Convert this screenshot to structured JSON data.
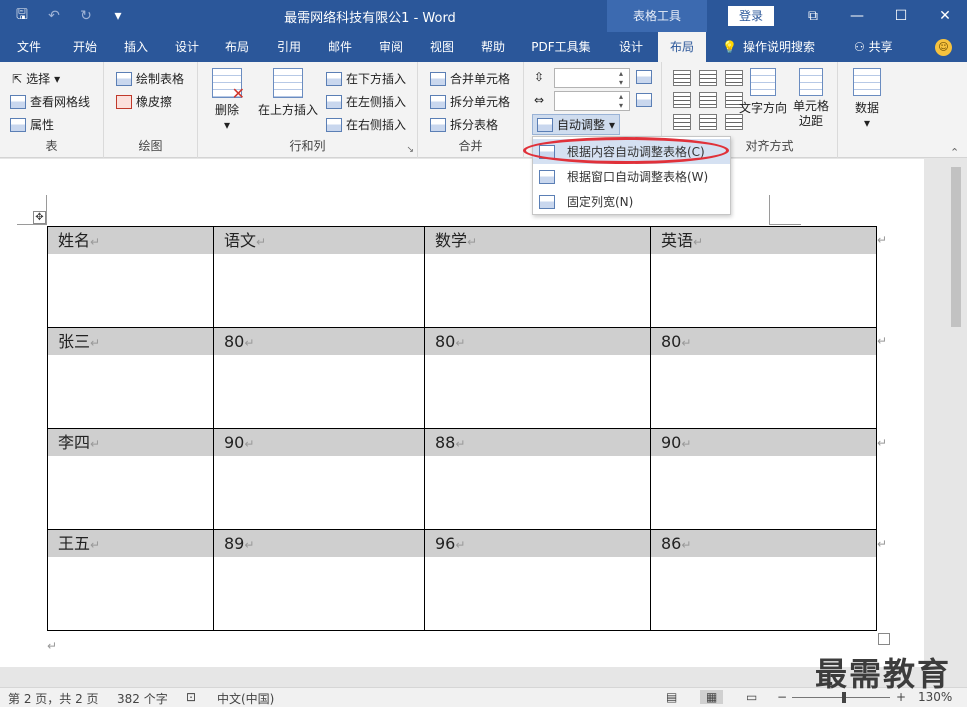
{
  "titlebar": {
    "title": "最需网络科技有限公1  -  Word",
    "context_tab_group": "表格工具",
    "login": "登录",
    "save_icon": "save-icon",
    "undo_icon": "undo-icon",
    "redo_icon": "redo-icon"
  },
  "tabs": [
    {
      "label": "文件"
    },
    {
      "label": "开始"
    },
    {
      "label": "插入"
    },
    {
      "label": "设计"
    },
    {
      "label": "布局"
    },
    {
      "label": "引用"
    },
    {
      "label": "邮件"
    },
    {
      "label": "审阅"
    },
    {
      "label": "视图"
    },
    {
      "label": "帮助"
    },
    {
      "label": "PDF工具集"
    },
    {
      "label": "设计"
    },
    {
      "label": "布局",
      "active": true
    }
  ],
  "tell_me": "操作说明搜索",
  "share": "共享",
  "ribbon": {
    "table_group": {
      "label": "表",
      "select": "选择",
      "view_grid": "查看网格线",
      "properties": "属性"
    },
    "draw_group": {
      "label": "绘图",
      "draw_table": "绘制表格",
      "eraser": "橡皮擦"
    },
    "rowcol_group": {
      "label": "行和列",
      "delete": "删除",
      "insert_above": "在上方插入",
      "insert_below": "在下方插入",
      "insert_left": "在左侧插入",
      "insert_right": "在右侧插入"
    },
    "merge_group": {
      "label": "合并",
      "merge_cells": "合并单元格",
      "split_cells": "拆分单元格",
      "split_table": "拆分表格"
    },
    "cellsize_group": {
      "autofit": "自动调整"
    },
    "align_group": {
      "label": "对齐方式",
      "text_direction": "文字方向",
      "cell_margins_1": "单元格",
      "cell_margins_2": "边距"
    },
    "data_group": {
      "label": "数据"
    }
  },
  "autofit_menu": [
    {
      "label": "根据内容自动调整表格(C)",
      "hover": true
    },
    {
      "label": "根据窗口自动调整表格(W)"
    },
    {
      "label": "固定列宽(N)"
    }
  ],
  "table": {
    "rows": [
      [
        "姓名",
        "语文",
        "数学",
        "英语"
      ],
      [
        "张三",
        "80",
        "80",
        "80"
      ],
      [
        "李四",
        "90",
        "88",
        "90"
      ],
      [
        "王五",
        "89",
        "96",
        "86"
      ]
    ],
    "paragraph_mark": "↵"
  },
  "watermark": "最需教育",
  "statusbar": {
    "page": "第 2 页，共 2 页",
    "words": "382 个字",
    "language": "中文(中国)",
    "zoom_minus": "−",
    "zoom_plus": "+",
    "zoom": "130%"
  }
}
